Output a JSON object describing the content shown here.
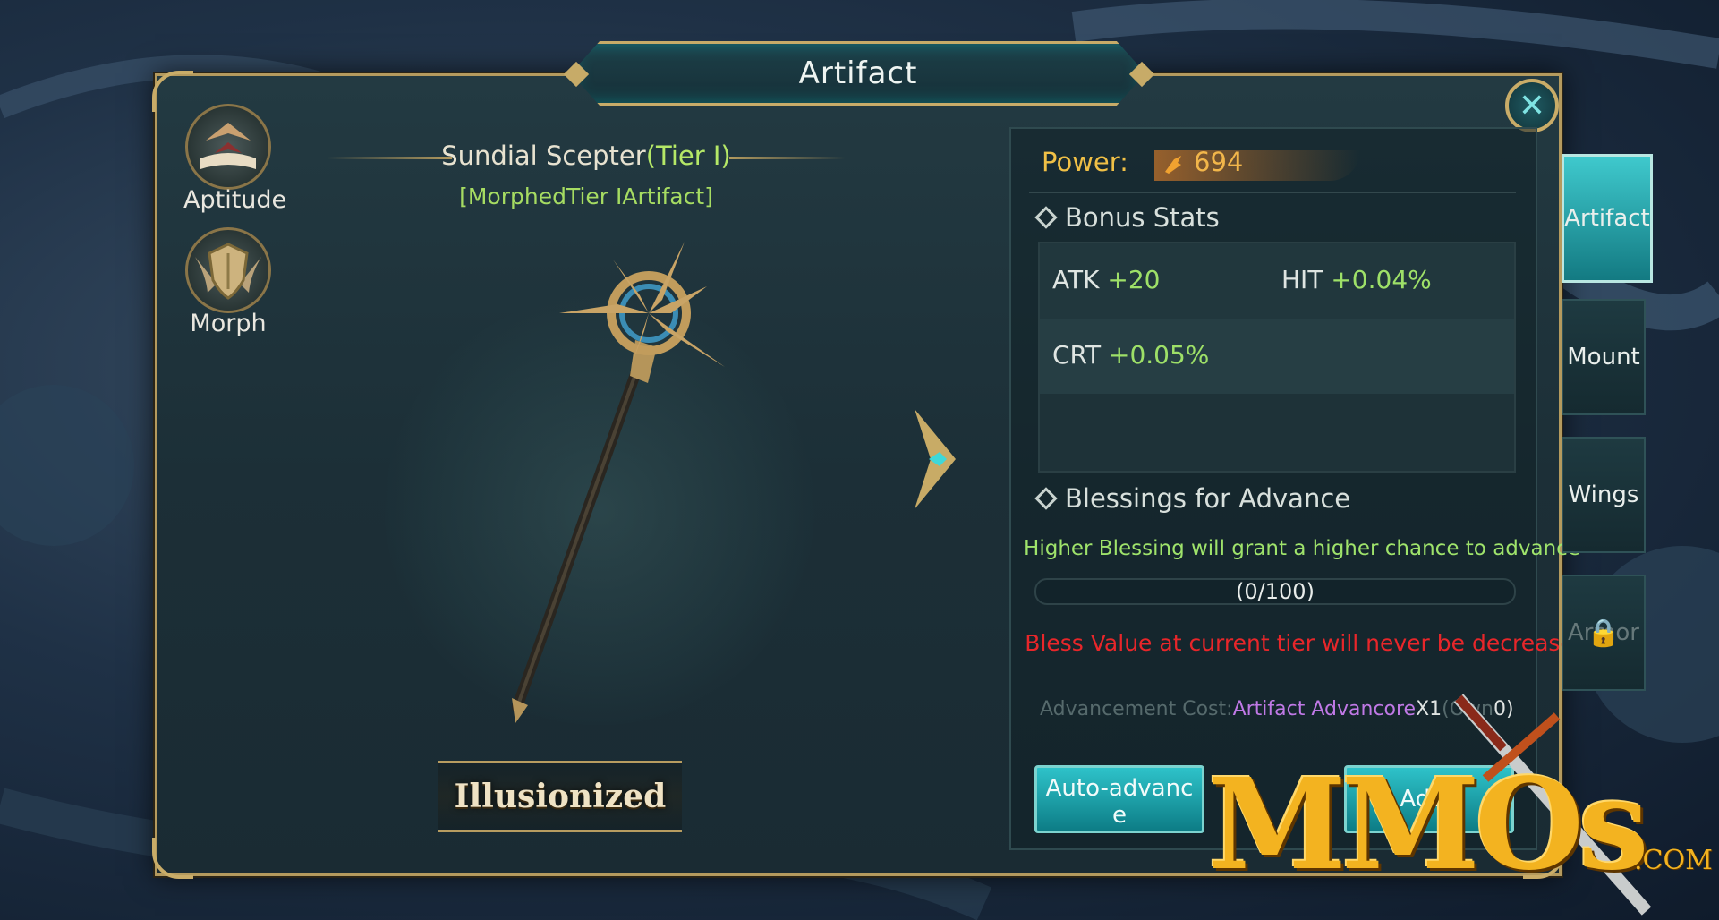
{
  "window": {
    "title": "Artifact"
  },
  "left_menu": [
    {
      "label": "Aptitude",
      "icon": "aptitude-book-icon"
    },
    {
      "label": "Morph",
      "icon": "morph-shield-icon"
    }
  ],
  "item": {
    "name": "Sundial Scepter",
    "tier": "(Tier I)",
    "subtitle": "[MorphedTier IArtifact]",
    "illusion_button": "Illusionized"
  },
  "power": {
    "label": "Power:",
    "value": "694"
  },
  "bonus_stats": {
    "heading": "Bonus Stats",
    "stats": [
      {
        "name": "ATK",
        "value": "+20"
      },
      {
        "name": "HIT",
        "value": "+0.04%"
      },
      {
        "name": "CRT",
        "value": "+0.05%"
      }
    ]
  },
  "blessings": {
    "heading": "Blessings for Advance",
    "hint": "Higher Blessing will grant a higher chance to advance",
    "progress_text": "(0/100)",
    "progress_fraction": 0,
    "warning": "Bless Value at current tier will never be decreased"
  },
  "cost": {
    "label": "Advancement Cost:",
    "item": "Artifact Advancore",
    "qty": "X1",
    "owned_prefix": "(Own",
    "owned_value": "0)"
  },
  "buttons": {
    "auto_advance": "Auto-advanc e",
    "advance": "Adva"
  },
  "tabs": [
    {
      "label": "Artifact",
      "active": true,
      "locked": false
    },
    {
      "label": "Mount",
      "active": false,
      "locked": false
    },
    {
      "label": "Wings",
      "active": false,
      "locked": false
    },
    {
      "label": "Armor",
      "active": false,
      "locked": true
    }
  ],
  "watermark": {
    "main": "MMOs",
    "suffix": ".COM"
  },
  "colors": {
    "accent_gold": "#c9ac68",
    "accent_teal": "#2ec2c9",
    "stat_green": "#9ee068",
    "warning_red": "#e8262a"
  }
}
